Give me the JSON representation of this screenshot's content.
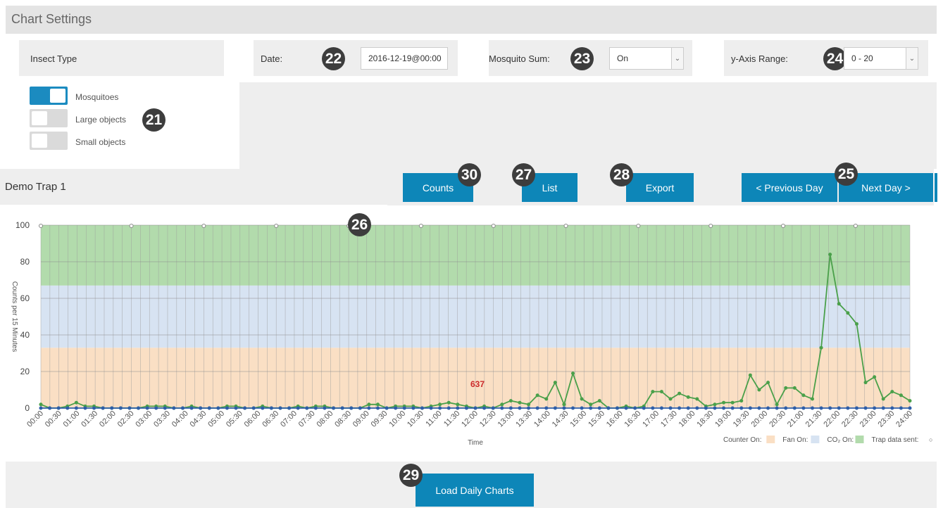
{
  "settings": {
    "title": "Chart Settings"
  },
  "insect_type": {
    "label": "Insect Type",
    "items": [
      {
        "label": "Mosquitoes",
        "on": true
      },
      {
        "label": "Large objects",
        "on": false
      },
      {
        "label": "Small objects",
        "on": false
      }
    ]
  },
  "date": {
    "label": "Date:",
    "value": "2016-12-19@00:00"
  },
  "mosquito_sum": {
    "label": "Mosquito Sum:",
    "value": "On"
  },
  "y_axis_range": {
    "label": "y-Axis Range:",
    "value": "0 - 20"
  },
  "trap": {
    "name": "Demo Trap 1"
  },
  "buttons": {
    "counts": "Counts",
    "list": "List",
    "export": "Export",
    "previous_day": "< Previous Day",
    "next_day": "Next Day >",
    "load_daily_charts": "Load Daily Charts"
  },
  "badges": {
    "insect_type": "21",
    "date": "22",
    "mosquito_sum": "23",
    "y_axis_range": "24",
    "next_day": "25",
    "chart": "26",
    "list": "27",
    "export": "28",
    "load_daily_charts": "29",
    "counts": "30"
  },
  "chart_data": {
    "type": "line",
    "xlabel": "Time",
    "ylabel": "Counts per 15 Minutes",
    "ylim": [
      0,
      100
    ],
    "yticks": [
      0,
      20,
      40,
      60,
      80,
      100
    ],
    "x_labels": [
      "00:00",
      "00:30",
      "01:00",
      "01:30",
      "02:00",
      "02:30",
      "03:00",
      "03:30",
      "04:00",
      "04:30",
      "05:00",
      "05:30",
      "06:00",
      "06:30",
      "07:00",
      "07:30",
      "08:00",
      "08:30",
      "09:00",
      "09:30",
      "10:00",
      "10:30",
      "11:00",
      "11:30",
      "12:00",
      "12:30",
      "13:00",
      "13:30",
      "14:00",
      "14:30",
      "15:00",
      "15:30",
      "16:00",
      "16:30",
      "17:00",
      "17:30",
      "18:00",
      "18:30",
      "19:00",
      "19:30",
      "20:00",
      "20:30",
      "21:00",
      "21:30",
      "22:00",
      "22:30",
      "23:00",
      "23:30",
      "24:00"
    ],
    "bands": [
      {
        "name": "Counter On",
        "from": 0,
        "to": 33,
        "color": "#fadfc4"
      },
      {
        "name": "Fan On",
        "from": 33,
        "to": 67,
        "color": "#d7e3f2"
      },
      {
        "name": "CO2 On",
        "from": 67,
        "to": 100,
        "color": "#b2dbac"
      }
    ],
    "series": [
      {
        "color": "#4aa04a",
        "values": [
          2,
          0,
          0,
          1,
          3,
          1,
          1,
          0,
          0,
          0,
          0,
          0,
          1,
          1,
          1,
          0,
          0,
          1,
          0,
          0,
          0,
          1,
          1,
          0,
          0,
          1,
          0,
          0,
          0,
          1,
          0,
          1,
          1,
          0,
          0,
          0,
          0,
          2,
          2,
          0,
          1,
          1,
          1,
          0,
          1,
          2,
          3,
          2,
          1,
          0,
          1,
          0,
          2,
          4,
          3,
          2,
          7,
          5,
          14,
          2,
          19,
          5,
          2,
          4,
          0,
          0,
          1,
          0,
          1,
          9,
          9,
          5,
          8,
          6,
          5,
          1,
          2,
          3,
          3,
          4,
          18,
          10,
          14,
          2,
          11,
          11,
          7,
          5,
          33,
          84,
          57,
          52,
          46,
          14,
          17,
          5,
          9,
          7,
          4
        ]
      },
      {
        "color": "#2e5ea8",
        "values": [
          0,
          0,
          0,
          0,
          0,
          0,
          0,
          0,
          0,
          0,
          0,
          0,
          0,
          0,
          0,
          0,
          0,
          0,
          0,
          0,
          0,
          0,
          0,
          0,
          0,
          0,
          0,
          0,
          0,
          0,
          0,
          0,
          0,
          0,
          0,
          0,
          0,
          0,
          0,
          0,
          0,
          0,
          0,
          0,
          0,
          0,
          0,
          0,
          0,
          0,
          0,
          0,
          0,
          0,
          0,
          0,
          0,
          0,
          0,
          0,
          0,
          0,
          0,
          0,
          0,
          0,
          0,
          0,
          0,
          0,
          0,
          0,
          0,
          0,
          0,
          0,
          0,
          0,
          0,
          0,
          0,
          0,
          0,
          0,
          0,
          0,
          0,
          0,
          0,
          0,
          0,
          0,
          0,
          0,
          0,
          0,
          0,
          0,
          0
        ]
      }
    ],
    "trap_data_sent_times": [
      "00:00",
      "02:30",
      "04:30",
      "06:30",
      "08:30",
      "10:30",
      "12:30",
      "14:30",
      "16:30",
      "18:30",
      "20:30",
      "22:30"
    ],
    "annotation": "637",
    "legend": [
      {
        "label": "Counter On:",
        "color": "#fadfc4"
      },
      {
        "label": "Fan On:",
        "color": "#d7e3f2"
      },
      {
        "label": "CO2 On:",
        "color": "#b2dbac"
      },
      {
        "label": "Trap data sent:",
        "marker": "○"
      }
    ]
  }
}
